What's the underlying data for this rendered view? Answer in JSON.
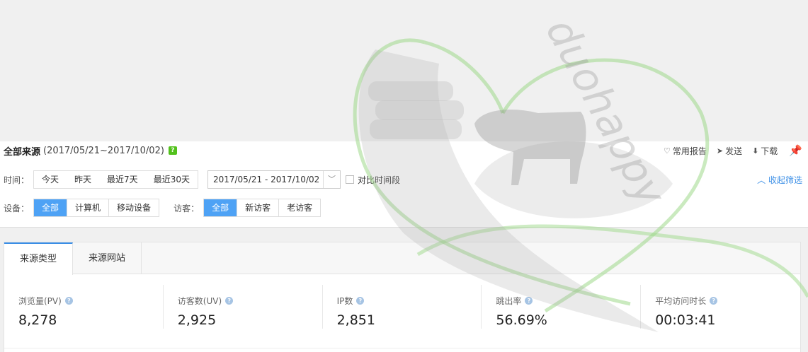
{
  "header": {
    "title": "全部来源",
    "date_range": "(2017/05/21~2017/10/02)",
    "help_badge": "?"
  },
  "actions": {
    "report": "常用报告",
    "send": "发送",
    "download": "下载"
  },
  "time_filter": {
    "label": "时间：",
    "options": [
      "今天",
      "昨天",
      "最近7天",
      "最近30天"
    ],
    "date_value": "2017/05/21 - 2017/10/02",
    "compare_label": "对比时间段",
    "collapse_label": "收起筛选"
  },
  "device_filter": {
    "label": "设备：",
    "options": [
      "全部",
      "计算机",
      "移动设备"
    ],
    "selected": "全部"
  },
  "visitor_filter": {
    "label": "访客：",
    "options": [
      "全部",
      "新访客",
      "老访客"
    ],
    "selected": "全部"
  },
  "tabs": [
    {
      "label": "来源类型",
      "active": true
    },
    {
      "label": "来源网站",
      "active": false
    }
  ],
  "metrics": [
    {
      "label": "浏览量(PV)",
      "value": "8,278"
    },
    {
      "label": "访客数(UV)",
      "value": "2,925"
    },
    {
      "label": "IP数",
      "value": "2,851"
    },
    {
      "label": "跳出率",
      "value": "56.69%"
    },
    {
      "label": "平均访问时长",
      "value": "00:03:41"
    }
  ],
  "watermark": {
    "text": "duohappy"
  },
  "colors": {
    "accent": "#4ea2f5",
    "link": "#3a8ee6",
    "help_green": "#52c11b"
  }
}
